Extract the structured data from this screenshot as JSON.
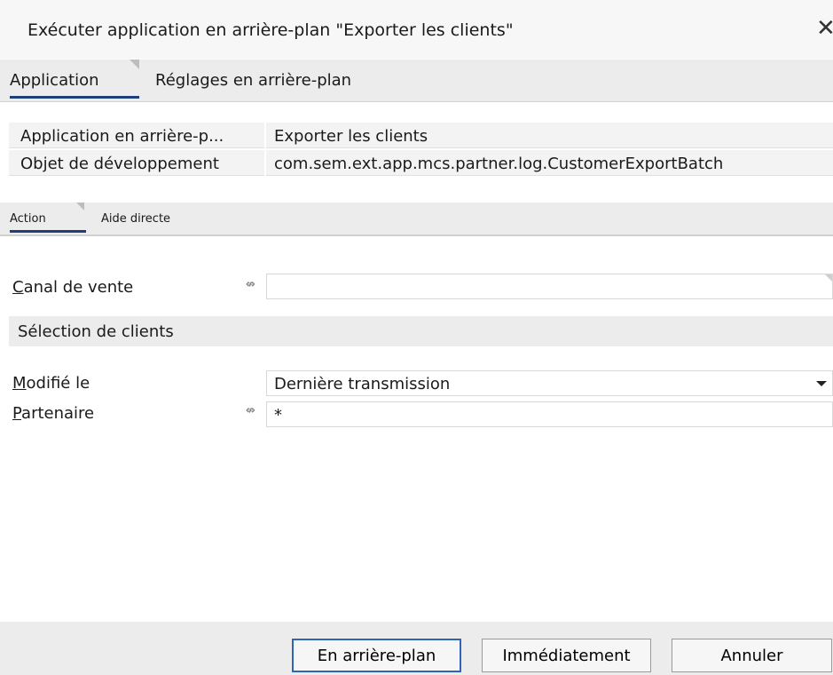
{
  "window": {
    "title": "Exécuter application en arrière-plan \"Exporter les clients\"",
    "close_glyph": "✕"
  },
  "top_tabs": [
    {
      "label": "Application",
      "active": true
    },
    {
      "label": "Réglages en arrière-plan",
      "active": false
    }
  ],
  "info": {
    "app_label": "Application en arrière-p...",
    "app_value": "Exporter les clients",
    "dev_label": "Objet de développement",
    "dev_value": "com.sem.ext.app.mcs.partner.log.CustomerExportBatch"
  },
  "sub_tabs": [
    {
      "label": "Action",
      "active": true
    },
    {
      "label": "Aide directe",
      "active": false
    }
  ],
  "form": {
    "canal": {
      "label_first": "C",
      "label_rest": "anal de vente",
      "value": ""
    },
    "section_title": "Sélection de clients",
    "modifie": {
      "label_first": "M",
      "label_rest": "odifié le",
      "value": "Dernière transmission"
    },
    "partenaire": {
      "label_first": "P",
      "label_rest": "artenaire",
      "value": "*"
    },
    "arrows_glyph": "⇎"
  },
  "buttons": {
    "background": "En arrière-plan",
    "immediate": "Immédiatement",
    "cancel": "Annuler"
  },
  "colors": {
    "accent": "#1f3f7a",
    "primary_border": "#2f64b8"
  }
}
